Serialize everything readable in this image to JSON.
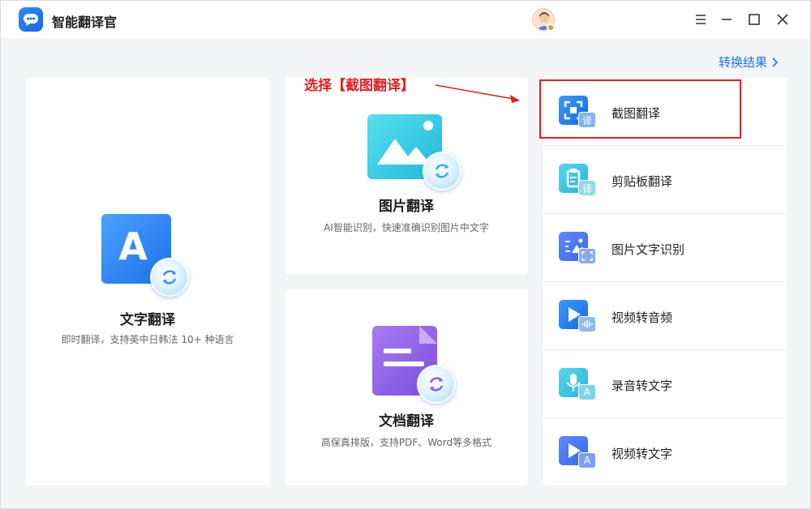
{
  "app": {
    "title": "智能翻译官"
  },
  "header": {
    "result_link": "转换结果"
  },
  "cards": {
    "text": {
      "title": "文字翻译",
      "desc": "即时翻译，支持英中日韩法 10+ 种语言",
      "icon_letter": "A"
    },
    "image": {
      "title": "图片翻译",
      "desc": "AI智能识别，快速准确识别图片中文字"
    },
    "doc": {
      "title": "文档翻译",
      "desc": "高保真排版，支持PDF、Word等多格式"
    }
  },
  "tools": [
    {
      "label": "截图翻译",
      "icon": "screenshot-translate-icon",
      "sub": "译"
    },
    {
      "label": "剪贴板翻译",
      "icon": "clipboard-translate-icon",
      "sub": "译"
    },
    {
      "label": "图片文字识别",
      "icon": "image-ocr-icon",
      "sub": ""
    },
    {
      "label": "视频转音频",
      "icon": "video-to-audio-icon",
      "sub": ""
    },
    {
      "label": "录音转文字",
      "icon": "audio-to-text-icon",
      "sub": "A"
    },
    {
      "label": "视频转文字",
      "icon": "video-to-text-icon",
      "sub": "A"
    }
  ],
  "annotation": {
    "text": "选择【截图翻译】"
  },
  "colors": {
    "accent": "#1a73e8",
    "annotation": "#e02020"
  }
}
